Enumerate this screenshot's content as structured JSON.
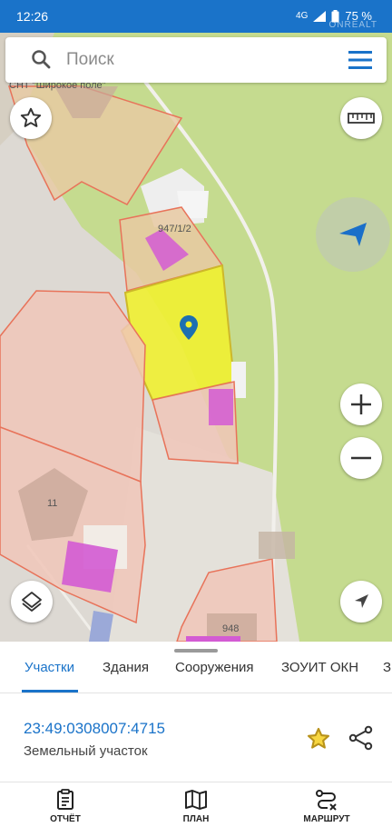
{
  "status": {
    "time": "12:26",
    "network": "4G",
    "battery": "75 %",
    "watermark": "ONREALT"
  },
  "search": {
    "placeholder": "Поиск"
  },
  "map": {
    "labels": {
      "top_area": "СНТ \"Широкое поле\"",
      "parcel_a": "947/1/2",
      "parcel_b": "11",
      "parcel_c": "948"
    },
    "colors": {
      "selected_parcel": "#f0f031",
      "parcel_border": "#e8735a",
      "building": "#d35bd3",
      "green_area": "#c4da8e"
    }
  },
  "controls": {
    "favorite_icon": "star-outline-icon",
    "ruler_icon": "ruler-icon",
    "compass_icon": "compass-arrow-icon",
    "zoom_in": "+",
    "zoom_out": "−",
    "layers_icon": "layers-icon",
    "locate_icon": "navigation-arrow-icon"
  },
  "tabs": [
    "Участки",
    "Здания",
    "Сооружения",
    "ЗОУИТ ОКН",
    "З"
  ],
  "active_tab": 0,
  "result": {
    "cadastral_number": "23:49:0308007:4715",
    "type": "Земельный участок"
  },
  "nav": [
    {
      "label": "ОТЧЁТ",
      "icon": "report-icon"
    },
    {
      "label": "ПЛАН",
      "icon": "map-icon"
    },
    {
      "label": "МАРШРУТ",
      "icon": "route-icon"
    }
  ]
}
